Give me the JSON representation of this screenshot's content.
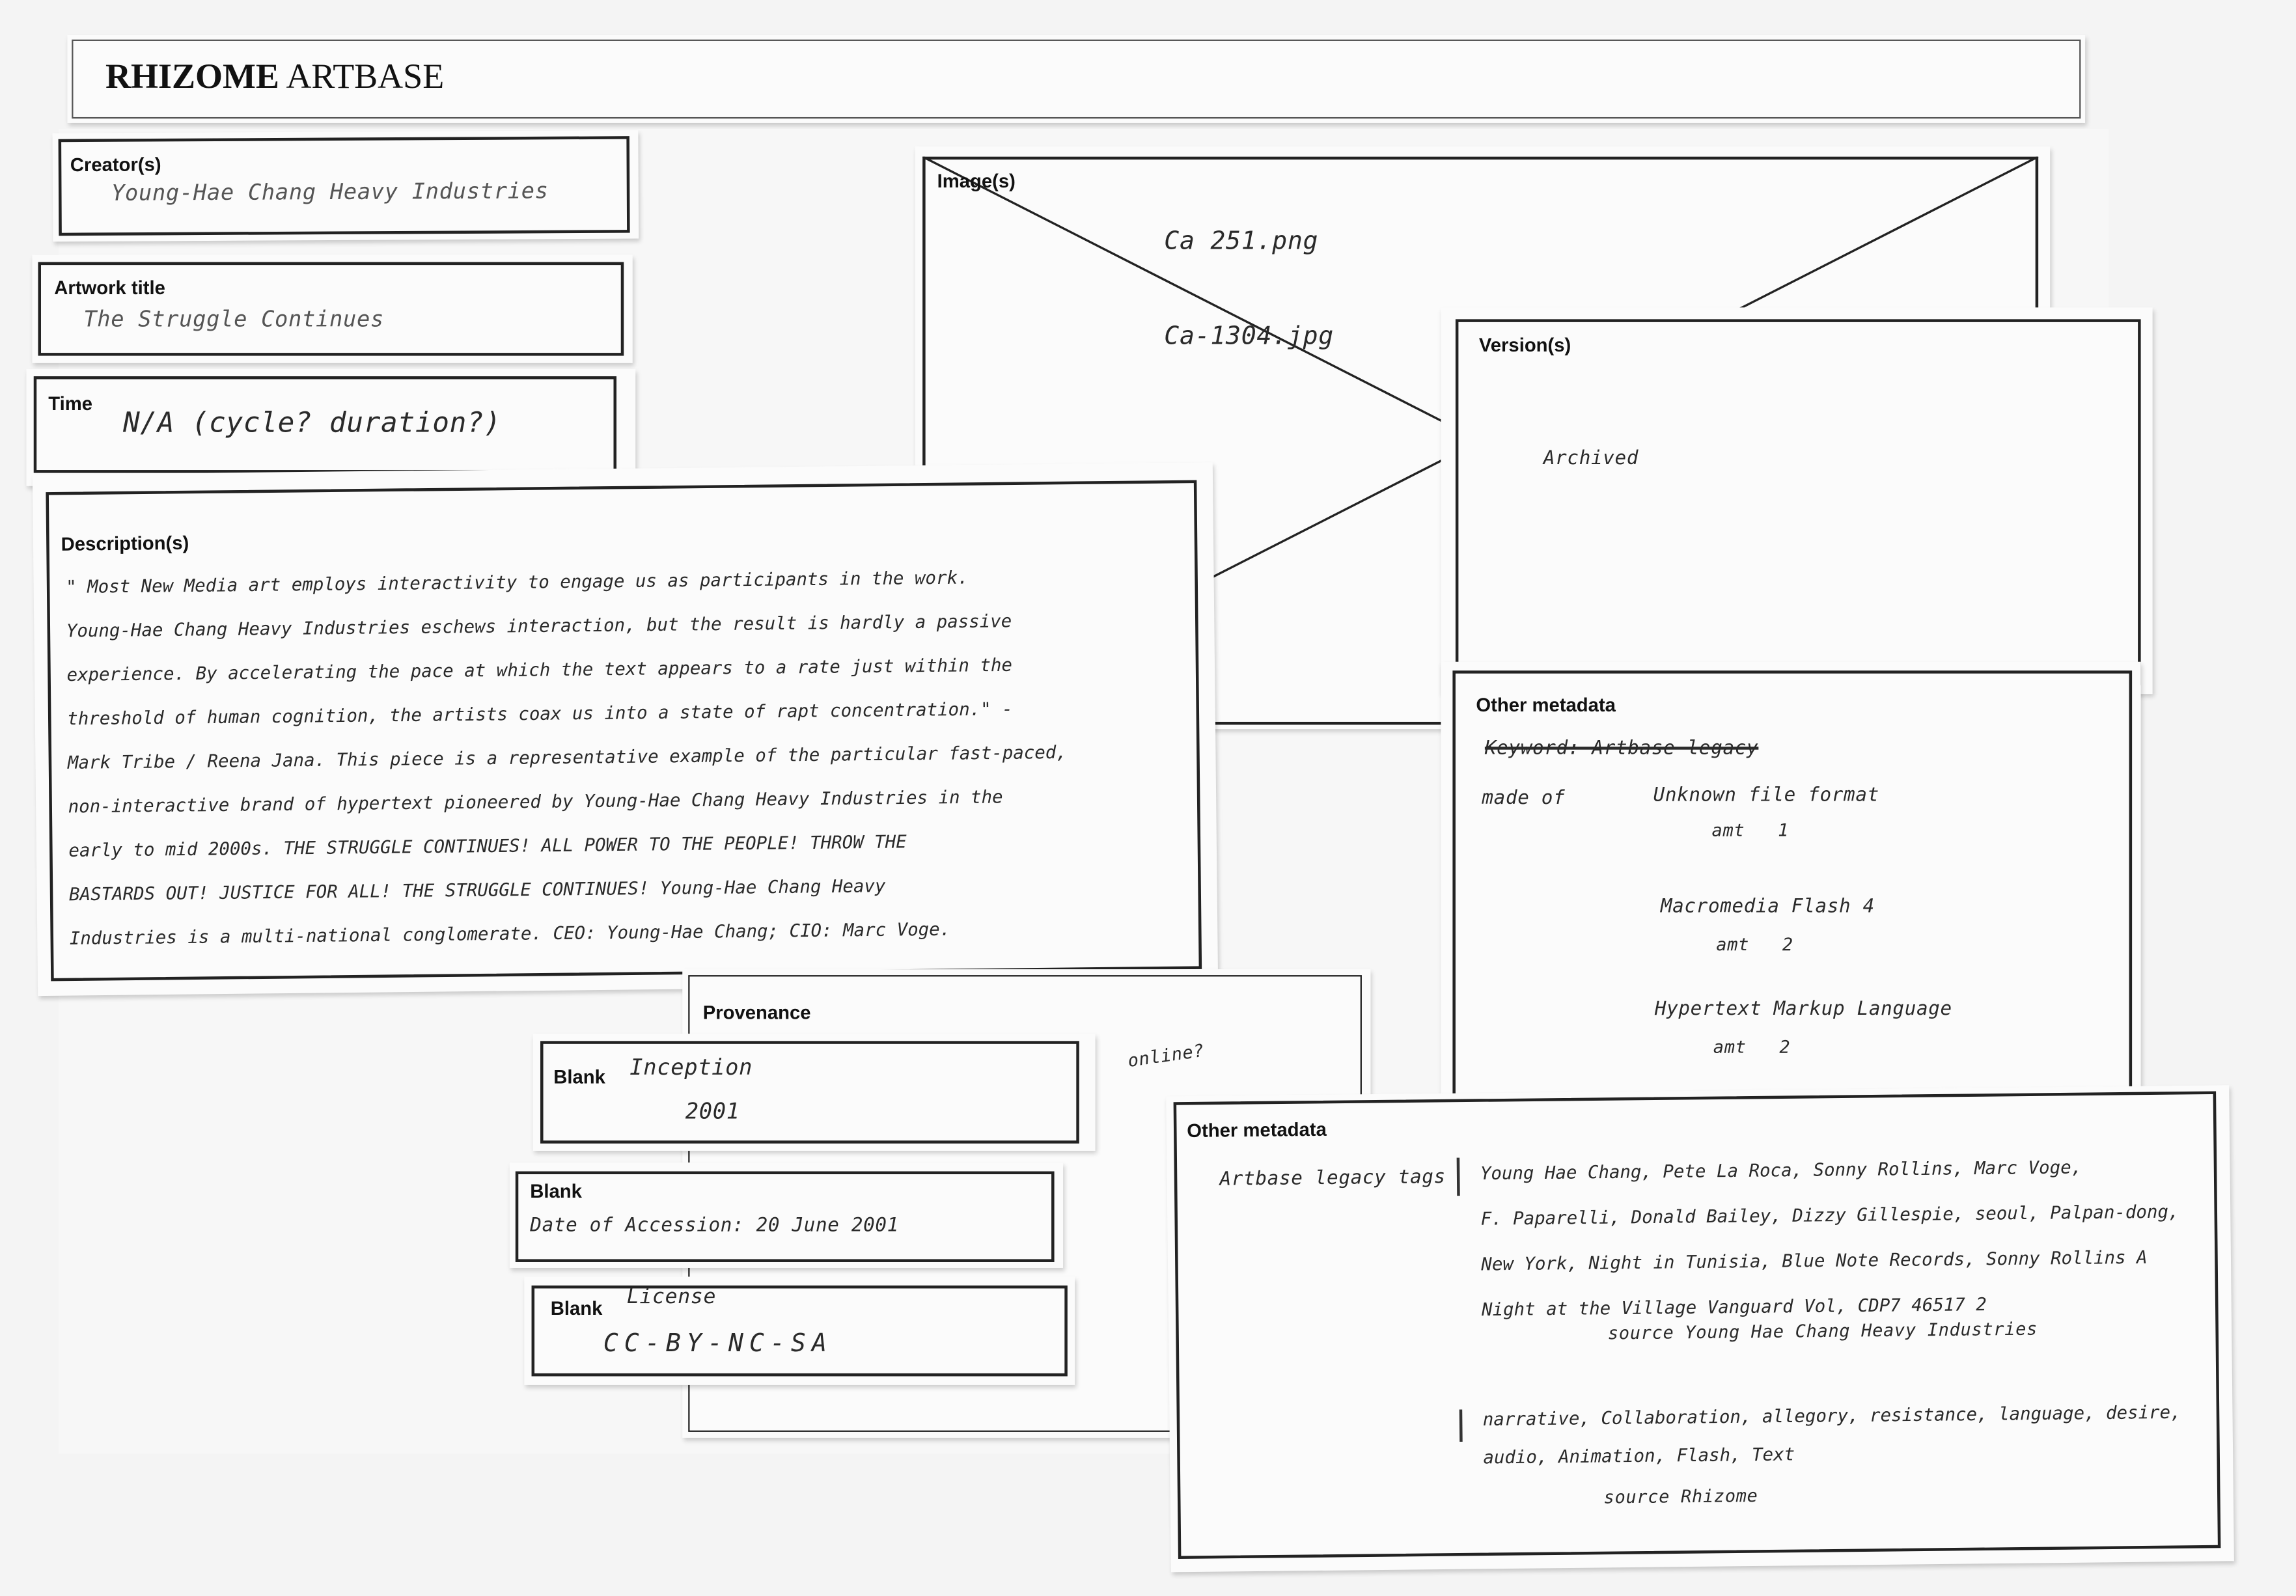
{
  "header": {
    "title_bold": "RHIZOME",
    "title_rest": " ARTBASE"
  },
  "creator": {
    "label": "Creator(s)",
    "value": "Young-Hae Chang Heavy Industries"
  },
  "artwork_title": {
    "label": "Artwork title",
    "value": "The Struggle Continues"
  },
  "time": {
    "label": "Time",
    "value": "N/A (cycle? duration?)"
  },
  "images": {
    "label": "Image(s)",
    "files": [
      "Ca 251.png",
      "Ca-1304.jpg"
    ]
  },
  "versions": {
    "label": "Version(s)",
    "value": "Archived"
  },
  "other_metadata_1": {
    "label": "Other metadata",
    "crossed_out": "Keyword: Artbase legacy",
    "made_of_label": "made of",
    "formats": [
      {
        "name": "Unknown file format",
        "amt_label": "amt",
        "amt": "1"
      },
      {
        "name": "Macromedia Flash 4",
        "amt_label": "amt",
        "amt": "2"
      },
      {
        "name": "Hypertext Markup Language",
        "amt_label": "amt",
        "amt": "2"
      }
    ]
  },
  "description": {
    "label": "Description(s)",
    "lines": [
      "\" Most New Media art employs interactivity to engage us as participants in the work.",
      "Young-Hae Chang Heavy Industries eschews interaction, but the result is hardly a passive",
      "experience. By accelerating the pace at which the text appears to a rate just within the",
      "threshold of human cognition, the artists coax us into a state of rapt concentration.\" -",
      "Mark Tribe / Reena Jana. This piece is a representative example of the particular fast-paced,",
      "non-interactive brand of hypertext pioneered by Young-Hae Chang Heavy Industries in the",
      "early to mid 2000s. THE STRUGGLE CONTINUES! ALL POWER TO THE PEOPLE! THROW THE",
      "BASTARDS OUT! JUSTICE FOR ALL! THE STRUGGLE CONTINUES! Young-Hae Chang Heavy",
      "Industries is a multi-national conglomerate. CEO: Young-Hae Chang; CIO: Marc Voge."
    ]
  },
  "provenance": {
    "label": "Provenance",
    "note": "online?",
    "blanks": [
      {
        "label": "Blank",
        "line1": "Inception",
        "line2": "2001"
      },
      {
        "label": "Blank",
        "line1": "Date of Accession: 20 June 2001",
        "line2": ""
      },
      {
        "label": "Blank",
        "line1": "License",
        "line2": "CC-BY-NC-SA"
      }
    ]
  },
  "other_metadata_2": {
    "label": "Other metadata",
    "tags_label": "Artbase legacy tags",
    "tags_lines": [
      "Young Hae Chang, Pete La Roca, Sonny Rollins, Marc Voge,",
      "F. Paparelli, Donald Bailey, Dizzy Gillespie, seoul, Palpan-dong,",
      "New York, Night in Tunisia, Blue Note Records, Sonny Rollins A",
      "Night at the Village Vanguard Vol, CDP7 46517 2"
    ],
    "tags_source": "source Young Hae Chang Heavy Industries",
    "tags2_lines": [
      "narrative, Collaboration, allegory, resistance, language, desire,",
      "audio, Animation, Flash, Text"
    ],
    "tags2_source": "source Rhizome"
  }
}
